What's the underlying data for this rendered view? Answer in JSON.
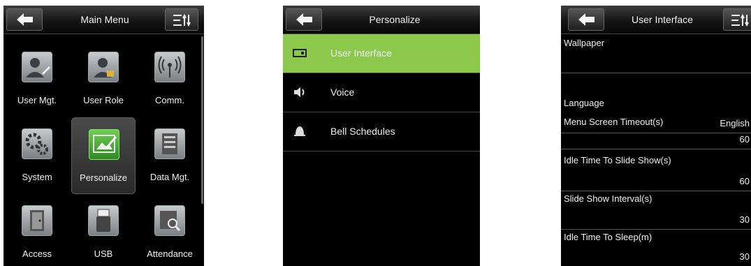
{
  "main_menu": {
    "title": "Main Menu",
    "items": [
      {
        "label": "User Mgt.",
        "icon": "user-edit-icon"
      },
      {
        "label": "User Role",
        "icon": "user-role-icon"
      },
      {
        "label": "Comm.",
        "icon": "wireless-icon"
      },
      {
        "label": "System",
        "icon": "gears-icon"
      },
      {
        "label": "Personalize",
        "icon": "personalize-icon",
        "selected": true
      },
      {
        "label": "Data Mgt.",
        "icon": "database-icon"
      },
      {
        "label": "Access",
        "icon": "door-icon"
      },
      {
        "label": "USB",
        "icon": "usb-icon"
      },
      {
        "label": "Attendance",
        "icon": "attendance-search-icon"
      }
    ]
  },
  "personalize": {
    "title": "Personalize",
    "items": [
      {
        "label": "User Interface",
        "icon": "display-icon",
        "selected": true
      },
      {
        "label": "Voice",
        "icon": "speaker-icon"
      },
      {
        "label": "Bell Schedules",
        "icon": "bell-icon"
      }
    ],
    "accent": "#8cc84b"
  },
  "user_interface": {
    "title": "User Interface",
    "settings": [
      {
        "name": "Wallpaper",
        "value": ""
      },
      {
        "name": "Language",
        "value": "English"
      },
      {
        "name": "Menu Screen Timeout(s)",
        "value": "60"
      },
      {
        "name": "Idle Time To Slide Show(s)",
        "value": "60"
      },
      {
        "name": "Slide Show Interval(s)",
        "value": "30"
      },
      {
        "name": "Idle Time To Sleep(m)",
        "value": "30"
      }
    ]
  }
}
